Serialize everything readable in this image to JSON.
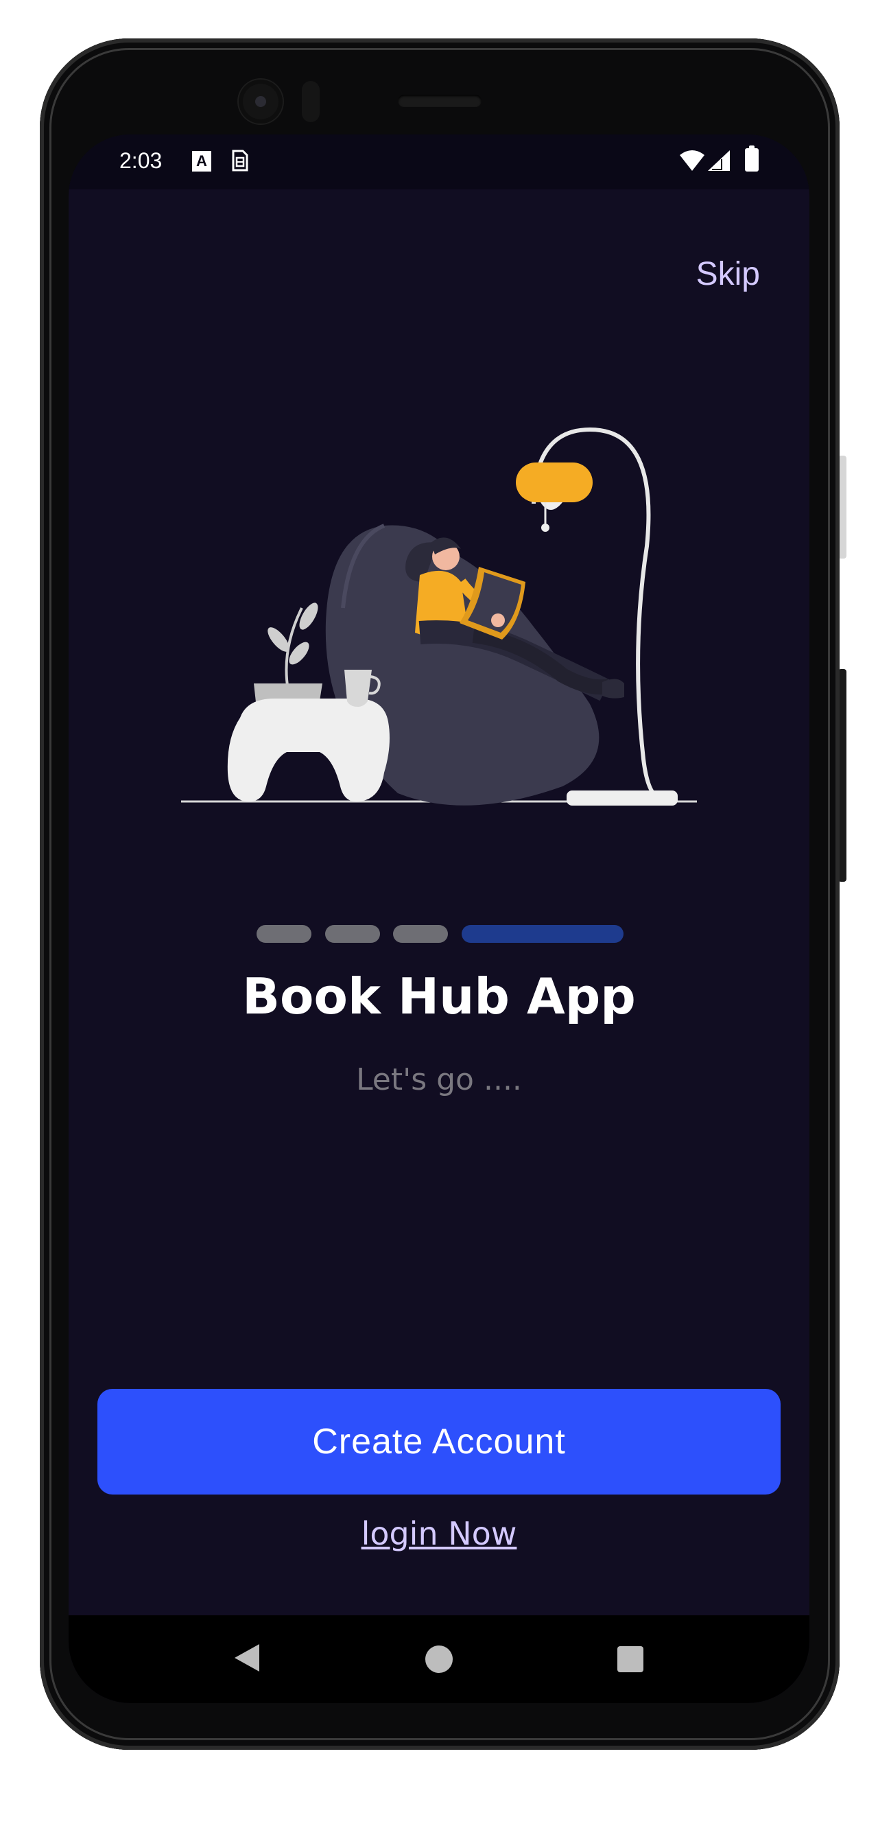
{
  "status_bar": {
    "time": "2:03",
    "notification_icon_a": "A"
  },
  "header": {
    "skip_label": "Skip"
  },
  "illustration": {
    "description_icon": "reading-woman-illustration-icon"
  },
  "onboarding": {
    "pages_total": 4,
    "current_page": 4,
    "title": "Book Hub App",
    "subtitle": "Let's go ...."
  },
  "actions": {
    "create_account_label": "Create Account",
    "login_label": "login Now"
  },
  "colors": {
    "background": "#110d22",
    "primary_button": "#2d50fc",
    "accent_text": "#d4c9ff",
    "active_indicator": "#1e3b8e",
    "inactive_indicator": "#6e6e74"
  }
}
